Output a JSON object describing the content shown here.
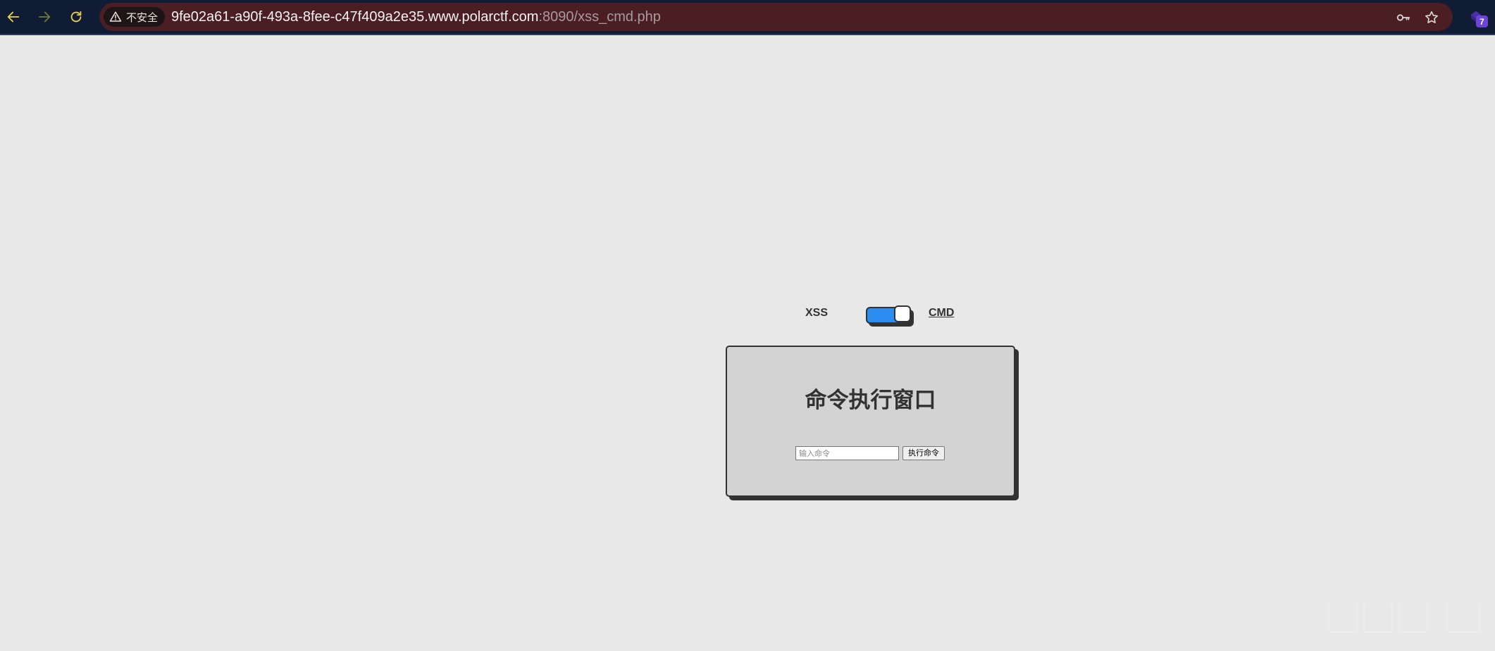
{
  "browser": {
    "security_label": "不安全",
    "url_host": "9fe02a61-a90f-493a-8fee-c47f409a2e35.www.polarctf.com",
    "url_path": ":8090/xss_cmd.php",
    "extension_badge": "7"
  },
  "switcher": {
    "left_label": "XSS",
    "right_label": "CMD",
    "selected": "CMD",
    "toggle_on": true
  },
  "card": {
    "title": "命令执行窗口",
    "input_placeholder": "输入命令",
    "input_value": "",
    "submit_label": "执行命令"
  },
  "colors": {
    "page_background": "#e8e8e8",
    "card_background": "#d3d3d3",
    "toggle_accent": "#2d8cf0",
    "border_dark": "#323232",
    "omnibox_warning": "#4a1e22"
  },
  "icons": {
    "back": "arrow-left-icon",
    "forward": "arrow-right-icon",
    "reload": "reload-icon",
    "security": "warning-triangle-icon",
    "passwords": "key-icon",
    "bookmark": "star-icon",
    "extension": "extension-icon"
  }
}
